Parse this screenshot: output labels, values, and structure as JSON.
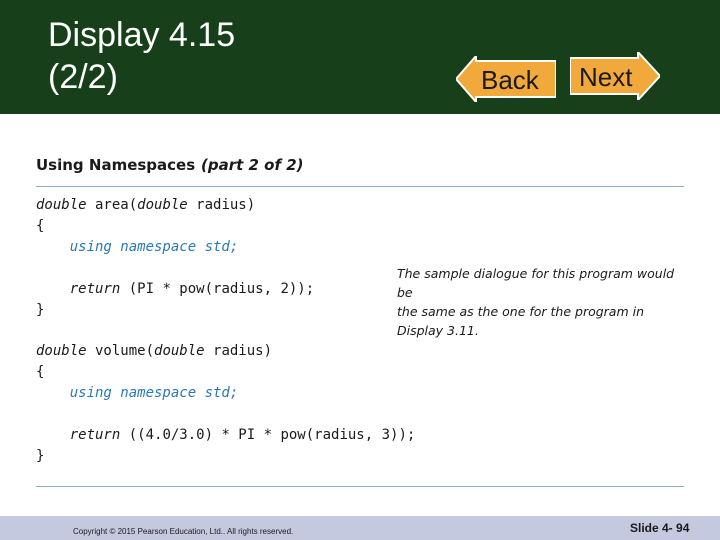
{
  "slide": {
    "title": "Display 4.15\n(2/2)",
    "back_label": "Back",
    "next_label": "Next"
  },
  "display": {
    "heading": "Using Namespaces",
    "part": "(part 2 of 2)",
    "code": {
      "l1_a": "double",
      "l1_b": " area(",
      "l1_c": "double",
      "l1_d": " radius)",
      "l2": "{",
      "l3": "    using namespace std;",
      "l4_a": "    return",
      "l4_b": " (PI * pow(radius, 2));",
      "l5": "}",
      "l6_a": "double",
      "l6_b": " volume(",
      "l6_c": "double",
      "l6_d": " radius)",
      "l7": "{",
      "l8": "    using namespace std;",
      "l9_a": "    return",
      "l9_b": " ((4.0/3.0) * PI * pow(radius, 3));",
      "l10": "}"
    },
    "note_line1": "The sample dialogue for this program would be",
    "note_line2": "the same as the one for the program in Display 3.11."
  },
  "footer": {
    "copyright": "Copyright © 2015 Pearson Education, Ltd.. All rights reserved.",
    "slide_number": "Slide 4- 94"
  },
  "colors": {
    "header_bg": "#163f1a",
    "button_fill": "#f2a93b",
    "code_blue": "#2a79b5",
    "footer_bg": "#c5c9e0"
  }
}
